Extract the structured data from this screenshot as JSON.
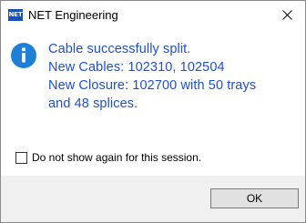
{
  "window": {
    "title": "NET Engineering",
    "app_icon_text": "NET",
    "close_icon": "close-icon"
  },
  "message": {
    "icon": "info-icon",
    "lines": [
      "Cable successfully split.",
      "New Cables: 102310, 102504",
      "New Closure: 102700 with 50 trays",
      "and 48 splices."
    ],
    "color": "#1f4ed8"
  },
  "option": {
    "label": "Do not show again for this session.",
    "checked": false
  },
  "footer": {
    "ok_label": "OK"
  },
  "colors": {
    "accent": "#1a4fb3",
    "info_blue": "#1d7fd6",
    "footer_bg": "#f0f0f0"
  }
}
